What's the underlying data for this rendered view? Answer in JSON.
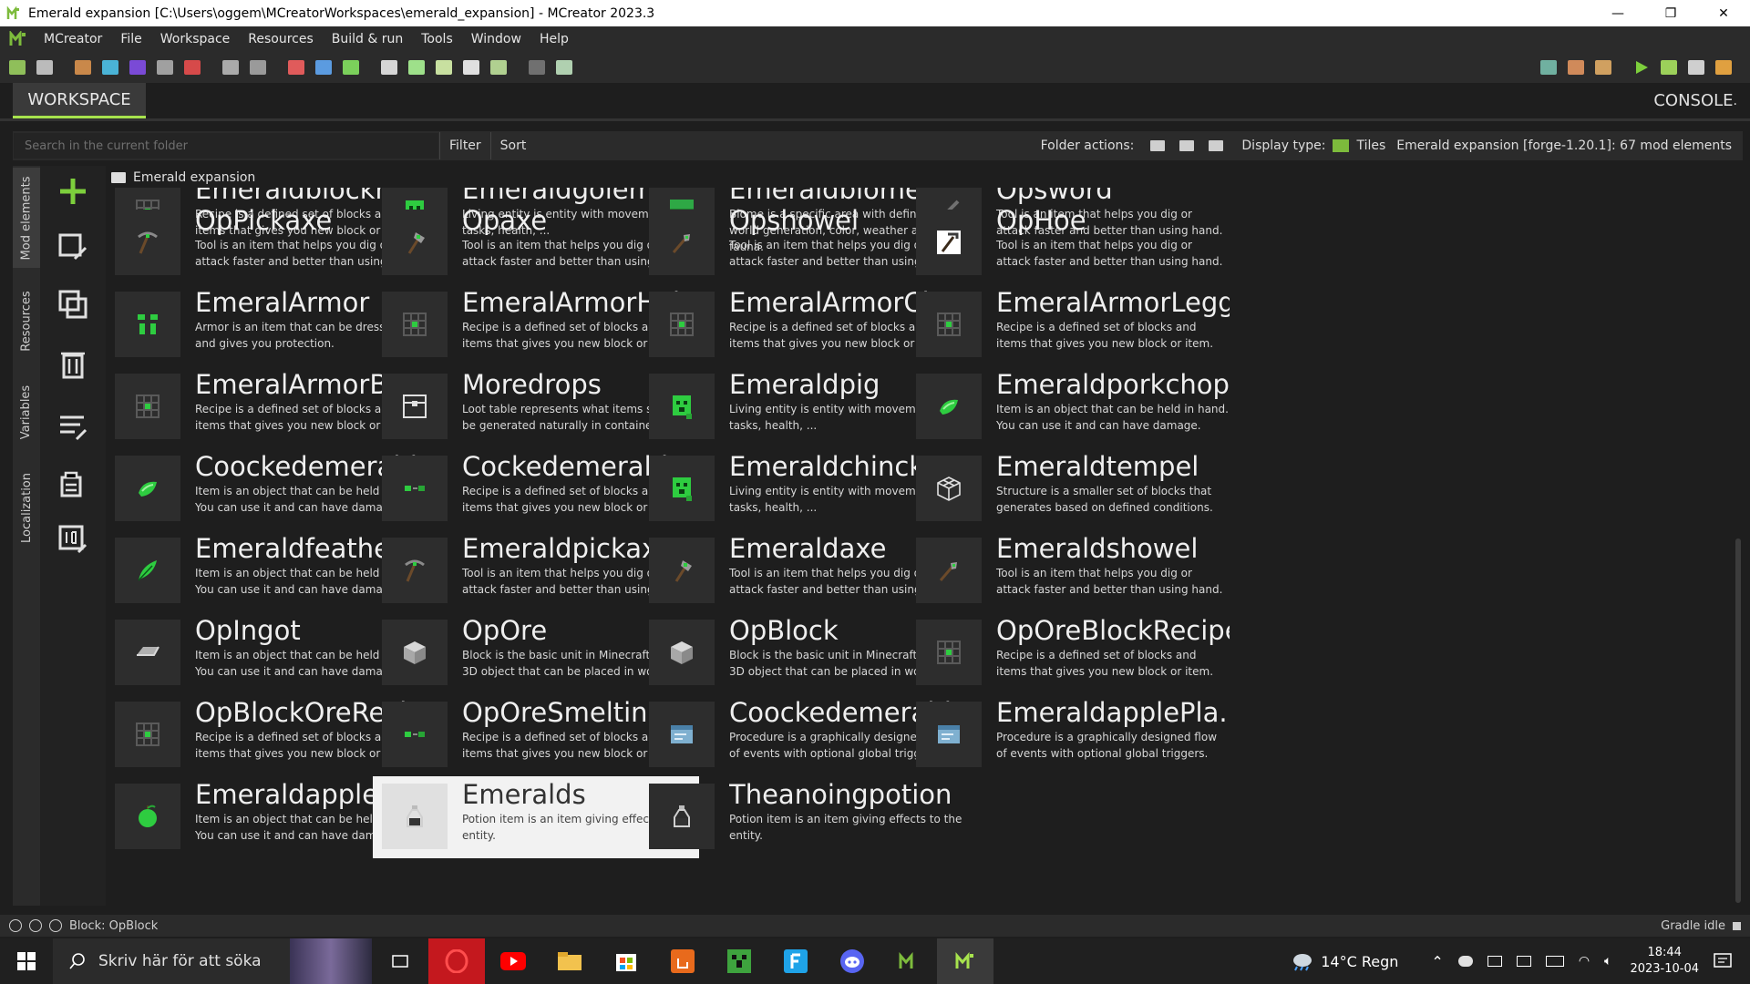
{
  "window": {
    "title": "Emerald expansion [C:\\Users\\oggem\\MCreatorWorkspaces\\emerald_expansion] - MCreator 2023.3",
    "minimize": "—",
    "maximize": "❐",
    "close": "✕"
  },
  "menu": [
    "MCreator",
    "File",
    "Workspace",
    "Resources",
    "Build & run",
    "Tools",
    "Window",
    "Help"
  ],
  "tabs": {
    "workspace": "WORKSPACE",
    "console": "CONSOLE"
  },
  "search": {
    "placeholder": "Search in the current folder",
    "filter": "Filter",
    "sort": "Sort",
    "folder_actions": "Folder actions:",
    "display_type": "Display type:",
    "display_value": "Tiles",
    "workspace_info": "Emerald expansion [forge-1.20.1]: 67 mod elements"
  },
  "side_tabs": [
    "Mod elements",
    "Resources",
    "Variables",
    "Localization"
  ],
  "breadcrumb": "Emerald expansion",
  "elements": [
    {
      "name": "Emeraldblockrec...",
      "desc": "Recipe is a defined set of blocks and items that gives you new block or item.",
      "icon": "recipe-icon"
    },
    {
      "name": "Emeraldgolem",
      "desc": "Living entity is entity with movement, AI tasks, health, ...",
      "icon": "entity-icon"
    },
    {
      "name": "Emeraldbiome",
      "desc": "Biome is a specific area with defined world generation, color, weather and fauna.",
      "icon": "biome-icon"
    },
    {
      "name": "Opsword",
      "desc": "Tool is an item that helps you dig or attack faster and better than using hand.",
      "icon": "sword-icon"
    },
    {
      "name": "OpPickaxe",
      "desc": "Tool is an item that helps you dig or attack faster and better than using hand.",
      "icon": "pickaxe-icon"
    },
    {
      "name": "Opaxe",
      "desc": "Tool is an item that helps you dig or attack faster and better than using hand.",
      "icon": "axe-icon"
    },
    {
      "name": "Opshowel",
      "desc": "Tool is an item that helps you dig or attack faster and better than using hand.",
      "icon": "shovel-icon"
    },
    {
      "name": "OpHoe",
      "desc": "Tool is an item that helps you dig or attack faster and better than using hand.",
      "icon": "hoe-icon"
    },
    {
      "name": "EmeralArmor",
      "desc": "Armor is an item that can be dressed up and gives you protection.",
      "icon": "armor-icon"
    },
    {
      "name": "EmeralArmorHelm...",
      "desc": "Recipe is a defined set of blocks and items that gives you new block or item.",
      "icon": "recipe-icon"
    },
    {
      "name": "EmeralArmorChes...",
      "desc": "Recipe is a defined set of blocks and items that gives you new block or item.",
      "icon": "recipe-icon"
    },
    {
      "name": "EmeralArmorLegg...",
      "desc": "Recipe is a defined set of blocks and items that gives you new block or item.",
      "icon": "recipe-icon"
    },
    {
      "name": "EmeralArmorBoot...",
      "desc": "Recipe is a defined set of blocks and items that gives you new block or item.",
      "icon": "recipe-icon"
    },
    {
      "name": "Moredrops",
      "desc": "Loot table represents what items should be generated naturally in containers.",
      "icon": "loot-table-icon"
    },
    {
      "name": "Emeraldpig",
      "desc": "Living entity is entity with movement, AI tasks, health, ...",
      "icon": "entity-icon"
    },
    {
      "name": "Emeraldporkchop",
      "desc": "Item is an object that can be held in hand. You can use it and can have damage.",
      "icon": "item-icon"
    },
    {
      "name": "Coockedemeraldp...",
      "desc": "Item is an object that can be held in hand. You can use it and can have damage.",
      "icon": "item-icon"
    },
    {
      "name": "Cockedemeraldpo...",
      "desc": "Recipe is a defined set of blocks and items that gives you new block or item.",
      "icon": "smelting-icon"
    },
    {
      "name": "Emeraldchincken",
      "desc": "Living entity is entity with movement, AI tasks, health, ...",
      "icon": "entity-icon"
    },
    {
      "name": "Emeraldtempel",
      "desc": "Structure is a smaller set of blocks that generates based on defined conditions.",
      "icon": "structure-icon"
    },
    {
      "name": "Emeraldfeather",
      "desc": "Item is an object that can be held in hand. You can use it and can have damage.",
      "icon": "feather-icon"
    },
    {
      "name": "Emeraldpickaxe",
      "desc": "Tool is an item that helps you dig or attack faster and better than using hand.",
      "icon": "pickaxe-icon"
    },
    {
      "name": "Emeraldaxe",
      "desc": "Tool is an item that helps you dig or attack faster and better than using hand.",
      "icon": "axe-icon"
    },
    {
      "name": "Emeraldshowel",
      "desc": "Tool is an item that helps you dig or attack faster and better than using hand.",
      "icon": "shovel-icon"
    },
    {
      "name": "OpIngot",
      "desc": "Item is an object that can be held in hand. You can use it and can have damage.",
      "icon": "ingot-icon"
    },
    {
      "name": "OpOre",
      "desc": "Block is the basic unit in Minecraft. It is 3D object that can be placed in world.",
      "icon": "block-icon"
    },
    {
      "name": "OpBlock",
      "desc": "Block is the basic unit in Minecraft. It is 3D object that can be placed in world.",
      "icon": "block-icon"
    },
    {
      "name": "OpOreBlockRecipe",
      "desc": "Recipe is a defined set of blocks and items that gives you new block or item.",
      "icon": "recipe-icon"
    },
    {
      "name": "OpBlockOreRecipe",
      "desc": "Recipe is a defined set of blocks and items that gives you new block or item.",
      "icon": "recipe-icon"
    },
    {
      "name": "OpOreSmelting",
      "desc": "Recipe is a defined set of blocks and items that gives you new block or item.",
      "icon": "smelting-icon"
    },
    {
      "name": "Coockedemeraldp...",
      "desc": "Procedure is a graphically designed flow of events with optional global triggers.",
      "icon": "procedure-icon"
    },
    {
      "name": "EmeraldapplePla...",
      "desc": "Procedure is a graphically designed flow of events with optional global triggers.",
      "icon": "procedure-icon"
    },
    {
      "name": "Emeraldapple",
      "desc": "Item is an object that can be held in hand. You can use it and can have damage.",
      "icon": "apple-icon"
    },
    {
      "name": "Emeralds",
      "desc": "Potion item is an item giving effects to the entity.",
      "icon": "potion-icon",
      "selected": true
    },
    {
      "name": "Theanoingpotion",
      "desc": "Potion item is an item giving effects to the entity.",
      "icon": "potion-icon"
    }
  ],
  "status": {
    "left": "Block: OpBlock",
    "right": "Gradle idle"
  },
  "taskbar": {
    "search_placeholder": "Skriv här för att söka",
    "weather": "14°C  Regn",
    "time": "18:44",
    "date": "2023-10-04"
  },
  "colors": {
    "accent": "#a7e34d",
    "emerald": "#2ecc40",
    "selected_bg": "#f2f2f2"
  }
}
